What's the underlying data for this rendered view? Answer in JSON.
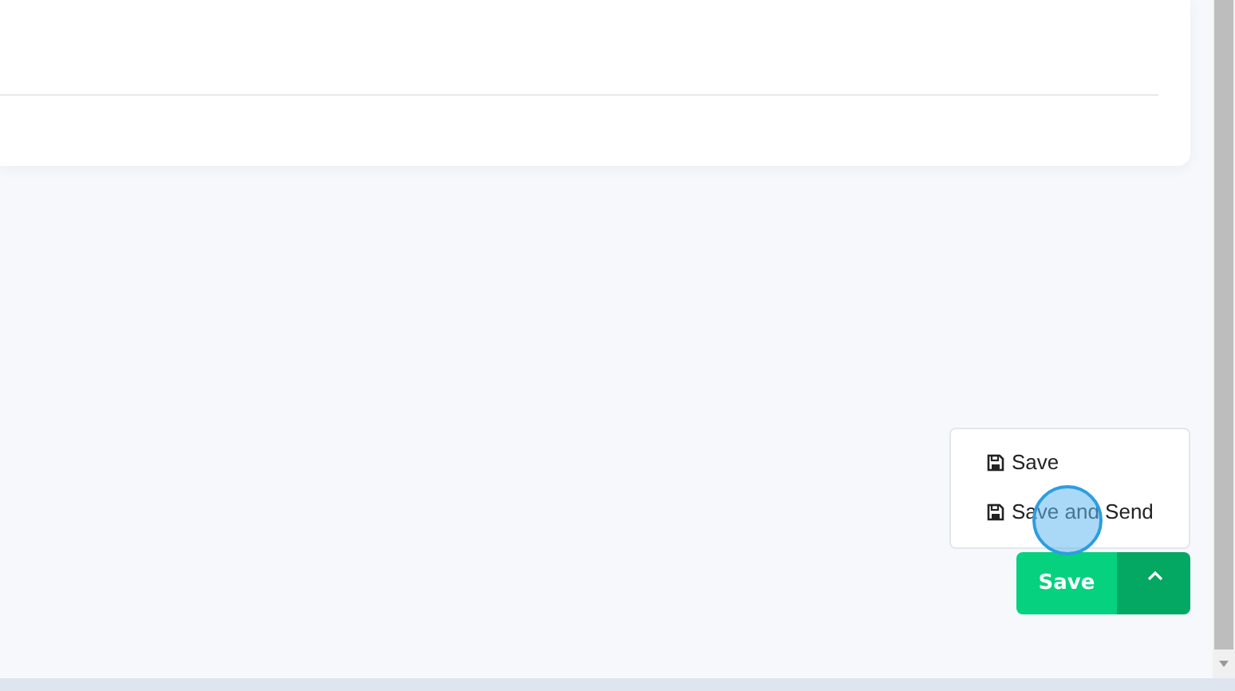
{
  "save_menu": {
    "open": true,
    "items": [
      {
        "label": "Save"
      },
      {
        "label": "Save and Send"
      }
    ]
  },
  "save_button": {
    "label": "Save"
  }
}
